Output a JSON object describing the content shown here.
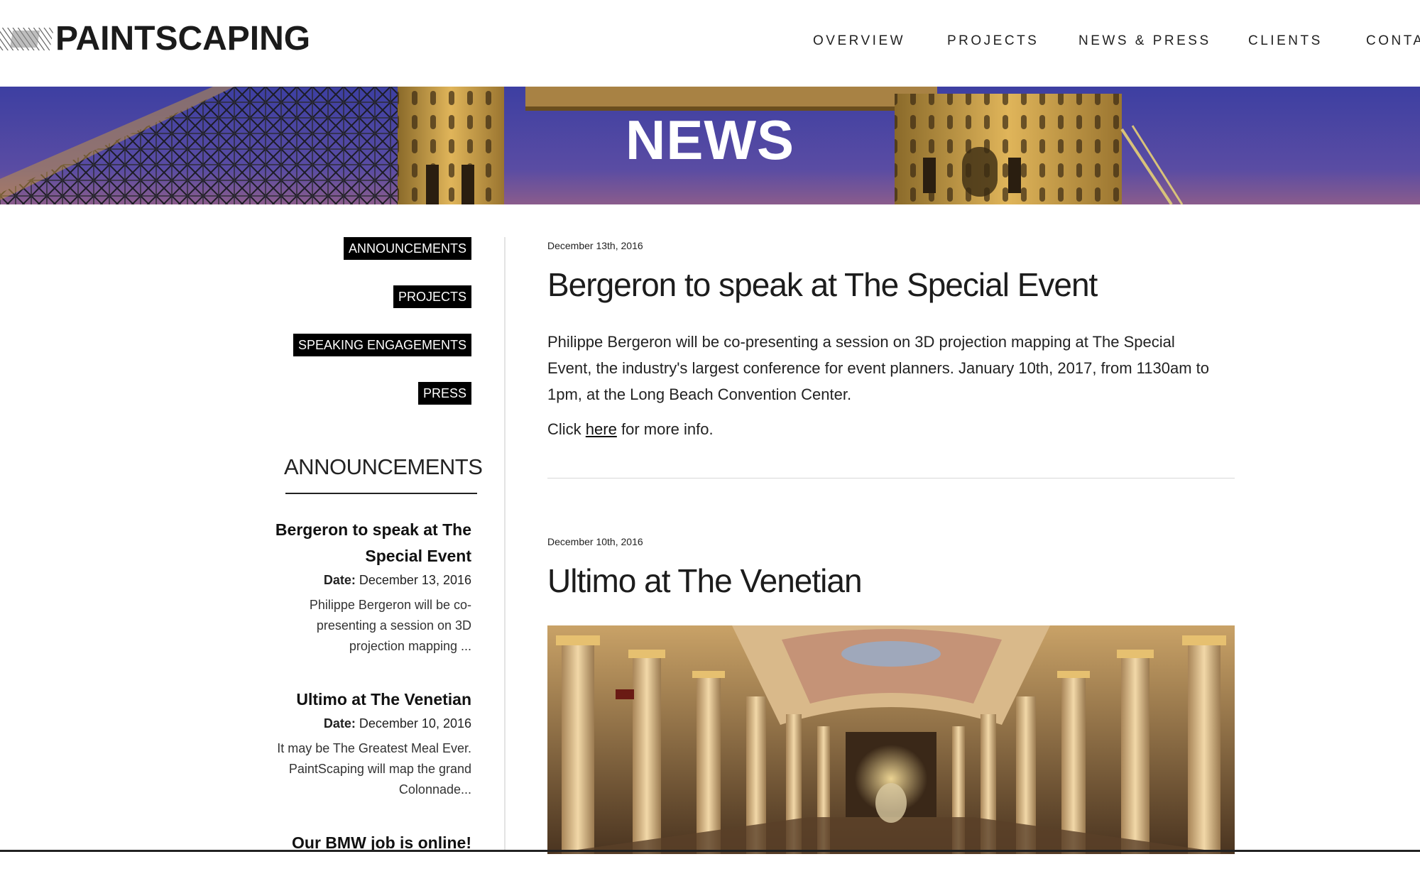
{
  "header": {
    "logo_text": "PAINTSCAPING",
    "nav": [
      {
        "label": "OVERVIEW"
      },
      {
        "label": "PROJECTS"
      },
      {
        "label": "NEWS & PRESS"
      },
      {
        "label": "CLIENTS"
      },
      {
        "label": "CONTA"
      }
    ]
  },
  "hero": {
    "title": "NEWS"
  },
  "sidebar": {
    "categories": [
      {
        "label": "ANNOUNCEMENTS"
      },
      {
        "label": "PROJECTS"
      },
      {
        "label": "SPEAKING ENGAGEMENTS"
      },
      {
        "label": "PRESS"
      }
    ],
    "heading": "ANNOUNCEMENTS",
    "date_label": "Date:",
    "items": [
      {
        "title": "Bergeron to speak at The Special Event",
        "date": "December 13, 2016",
        "excerpt": "Philippe Bergeron will be co-presenting a session on 3D projection mapping ..."
      },
      {
        "title": "Ultimo at The Venetian",
        "date": "December 10, 2016",
        "excerpt": "It may be The Greatest Meal Ever. PaintScaping will map the grand Colonnade..."
      },
      {
        "title": "Our BMW job is online!"
      }
    ]
  },
  "posts": [
    {
      "date": "December 13th, 2016",
      "title": "Bergeron to speak at The Special Event",
      "body": "Philippe Bergeron will be co-presenting a session on 3D projection mapping at The Special Event, the industry's largest conference for event planners. January 10th, 2017, from 1130am to 1pm, at the Long Beach Convention Center.",
      "link_prefix": "Click",
      "link_text": "here",
      "link_suffix": "for more info."
    },
    {
      "date": "December 10th, 2016",
      "title": "Ultimo at The Venetian"
    }
  ],
  "colors": {
    "tag_background": "#000000",
    "tag_text": "#ffffff",
    "hero_sky": "#4a48a8",
    "text": "#1a1a1a",
    "divider": "#e3e3e3"
  }
}
